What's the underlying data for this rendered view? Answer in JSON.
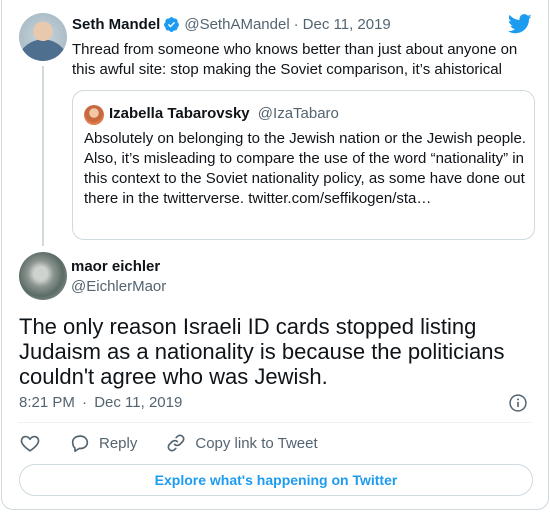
{
  "parent_tweet": {
    "name": "Seth Mandel",
    "handle": "@SethAMandel",
    "separator": "·",
    "date": "Dec 11, 2019",
    "text": "Thread from someone who knows better than just about anyone on this awful site: stop making the Soviet comparison, it’s ahistorical",
    "verified": true
  },
  "quoted_tweet": {
    "name": "Izabella Tabarovsky",
    "handle": "@IzaTabaro",
    "text": "Absolutely on belonging to the Jewish nation or the Jewish people. Also, it’s misleading to compare the use of the word “nationality” in this context  to the Soviet nationality policy, as some have done out there in the twitterverse. twitter.com/seffikogen/sta…"
  },
  "main_tweet": {
    "name": "maor eichler",
    "handle": "@EichlerMaor",
    "text": "The only reason Israeli ID cards stopped listing Judaism as a nationality is because the politicians couldn't agree who was Jewish.",
    "time": "8:21 PM",
    "separator": "·",
    "date": "Dec 11, 2019"
  },
  "actions": {
    "reply_label": "Reply",
    "copy_link_label": "Copy link to Tweet"
  },
  "explore_button_label": "Explore what's happening on Twitter",
  "icons": {
    "brand": "twitter-bird-icon",
    "verified": "verified-badge-icon",
    "info": "info-icon",
    "like": "heart-icon",
    "reply": "speech-bubble-icon",
    "copy_link": "link-icon"
  },
  "colors": {
    "accent": "#1d9bf0",
    "text": "#0f1419",
    "secondary_text": "#536471",
    "border": "#cfd9de"
  }
}
